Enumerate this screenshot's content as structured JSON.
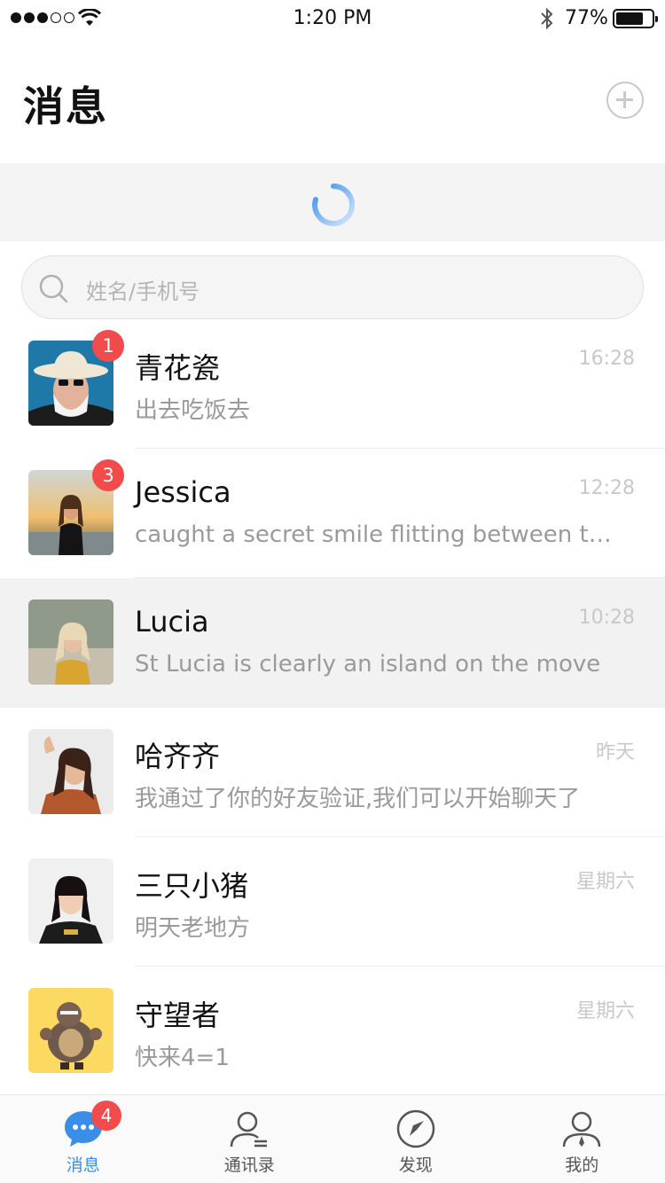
{
  "status_bar": {
    "time": "1:20 PM",
    "battery": "77%",
    "battery_level": 0.77
  },
  "header": {
    "title": "消息"
  },
  "search": {
    "placeholder": "姓名/手机号"
  },
  "chats": [
    {
      "name": "青花瓷",
      "time": "16:28",
      "preview": "出去吃饭去",
      "badge": "1"
    },
    {
      "name": "Jessica",
      "time": "12:28",
      "preview": "caught a secret smile flitting between the two",
      "badge": "3"
    },
    {
      "name": "Lucia",
      "time": "10:28",
      "preview": "St Lucia is clearly an island on the move",
      "badge": ""
    },
    {
      "name": "哈齐齐",
      "time": "昨天",
      "preview": "我通过了你的好友验证,我们可以开始聊天了",
      "badge": ""
    },
    {
      "name": "三只小猪",
      "time": "星期六",
      "preview": "明天老地方",
      "badge": ""
    },
    {
      "name": "守望者",
      "time": "星期六",
      "preview": "快来4=1",
      "badge": ""
    }
  ],
  "tabs": [
    {
      "label": "消息",
      "badge": "4"
    },
    {
      "label": "通讯录"
    },
    {
      "label": "发现"
    },
    {
      "label": "我的"
    }
  ],
  "colors": {
    "accent": "#3a8ee8",
    "badge": "#f24b4b"
  }
}
